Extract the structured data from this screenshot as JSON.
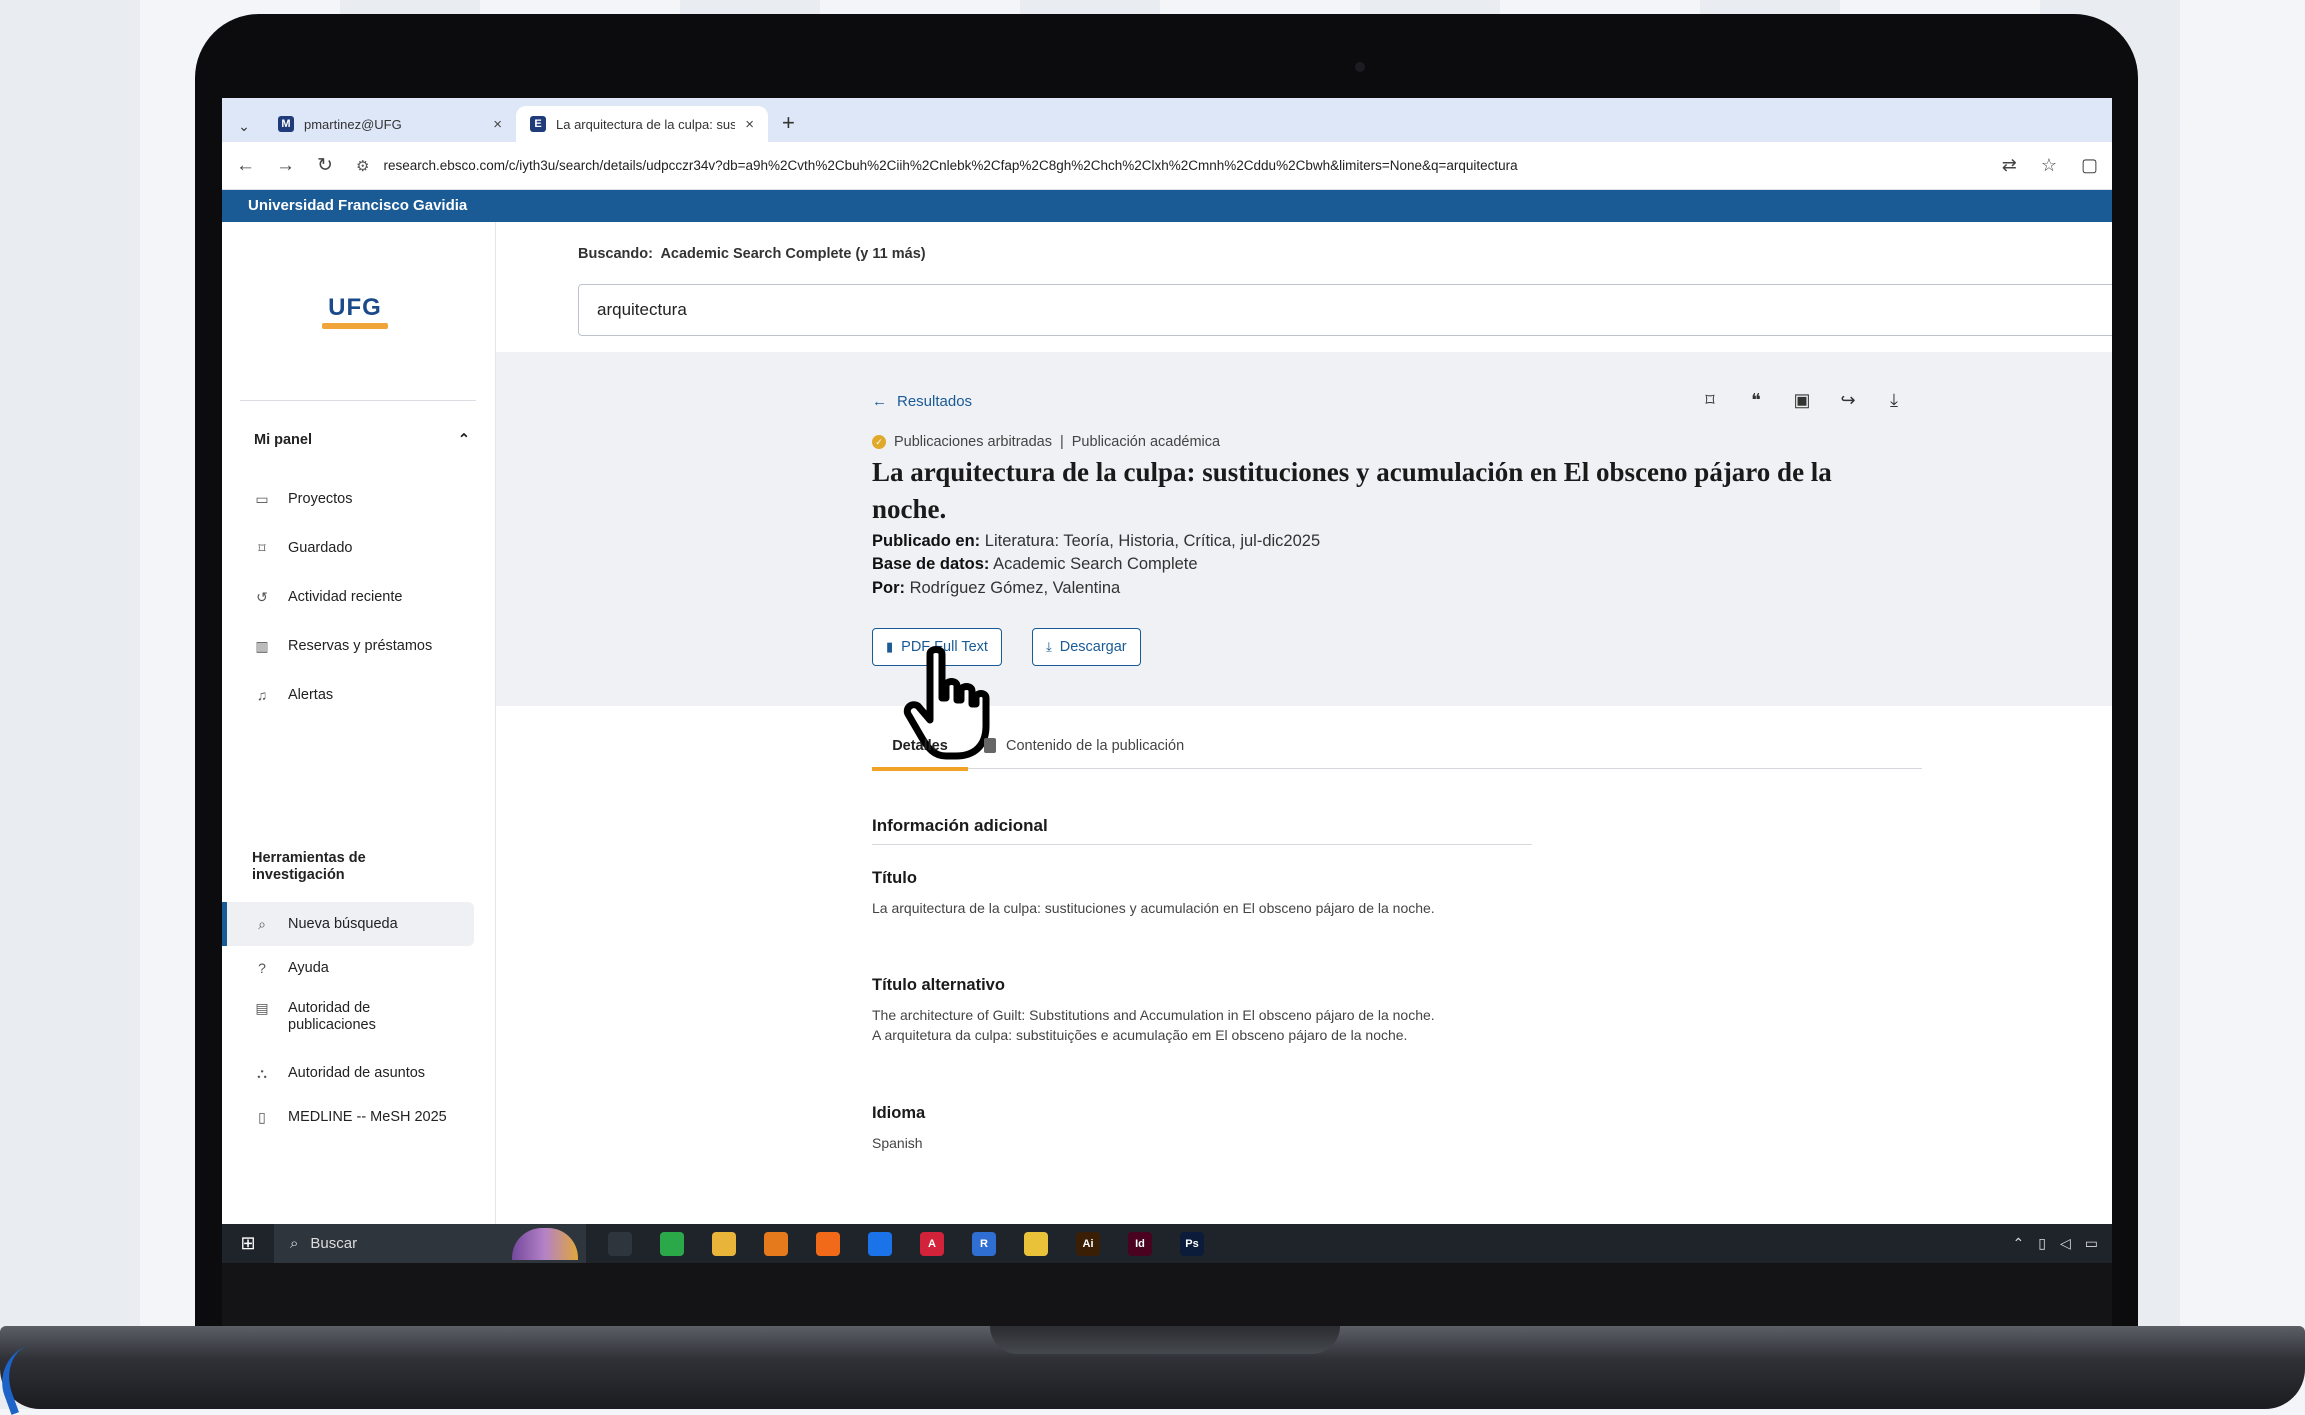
{
  "browser": {
    "tabs": [
      {
        "title": "pmartinez@UFG",
        "favicon": "M",
        "active": false
      },
      {
        "title": "La arquitectura de la culpa: sust",
        "favicon": "E",
        "active": true
      }
    ],
    "url": "research.ebsco.com/c/iyth3u/search/details/udpcczr34v?db=a9h%2Cvth%2Cbuh%2Ciih%2Cnlebk%2Cfap%2C8gh%2Chch%2Clxh%2Cmnh%2Cddu%2Cbwh&limiters=None&q=arquitectura"
  },
  "institution": "Universidad Francisco Gavidia",
  "logo": "UFG",
  "sidebar": {
    "panel_title": "Mi panel",
    "items": [
      {
        "label": "Proyectos",
        "icon": "folder-icon"
      },
      {
        "label": "Guardado",
        "icon": "bookmark-icon"
      },
      {
        "label": "Actividad reciente",
        "icon": "history-icon"
      },
      {
        "label": "Reservas y préstamos",
        "icon": "books-icon"
      },
      {
        "label": "Alertas",
        "icon": "bell-icon"
      }
    ],
    "tools_title_1": "Herramientas de",
    "tools_title_2": "investigación",
    "tools": [
      {
        "label": "Nueva búsqueda",
        "icon": "search-icon"
      },
      {
        "label": "Ayuda",
        "icon": "help-icon"
      },
      {
        "label_1": "Autoridad de",
        "label_2": "publicaciones",
        "icon": "document-icon"
      },
      {
        "label": "Autoridad de asuntos",
        "icon": "hierarchy-icon"
      },
      {
        "label": "MEDLINE -- MeSH 2025",
        "icon": "clipboard-icon"
      }
    ]
  },
  "search": {
    "scope_label": "Buscando:",
    "scope_value": "Academic Search Complete (y 11 más)",
    "query": "arquitectura"
  },
  "article": {
    "back_label": "Resultados",
    "badge_1": "Publicaciones arbitradas",
    "badge_2": "Publicación académica",
    "title": "La arquitectura de la culpa: sustituciones y acumulación en El obsceno pájaro de la noche.",
    "published_label": "Publicado en:",
    "published_value": "Literatura: Teoría, Historia, Crítica, jul-dic2025",
    "database_label": "Base de datos:",
    "database_value": "Academic Search Complete",
    "author_label": "Por:",
    "author_value": "Rodríguez Gómez, Valentina",
    "pdf_button": "PDF Full Text",
    "download_button": "Descargar"
  },
  "detail_tabs": {
    "details": "Detalles",
    "contents": "Contenido de la publicación"
  },
  "info": {
    "section_title": "Información adicional",
    "title_label": "Título",
    "title_value": "La arquitectura de la culpa: sustituciones y acumulación en El obsceno pájaro de la noche.",
    "alt_title_label": "Título alternativo",
    "alt_title_1": "The architecture of Guilt: Substitutions and Accumulation in El obsceno pájaro de la noche.",
    "alt_title_2": "A arquitetura da culpa: substituições e acumulação em El obsceno pájaro de la noche.",
    "language_label": "Idioma",
    "language_value": "Spanish"
  },
  "taskbar": {
    "search_label": "Buscar",
    "apps": [
      {
        "label": "",
        "color": "#2f353d"
      },
      {
        "label": "",
        "color": "#2aa84a"
      },
      {
        "label": "",
        "color": "#e8b43a"
      },
      {
        "label": "",
        "color": "#e47a1c"
      },
      {
        "label": "",
        "color": "#f06a1a"
      },
      {
        "label": "",
        "color": "#1a73e8"
      },
      {
        "label": "A",
        "color": "#d3233a"
      },
      {
        "label": "R",
        "color": "#2f6fd4"
      },
      {
        "label": "",
        "color": "#e9c23a"
      },
      {
        "label": "Ai",
        "color": "#3a1f06"
      },
      {
        "label": "Id",
        "color": "#49021f"
      },
      {
        "label": "Ps",
        "color": "#0a1c3a"
      }
    ]
  },
  "colors": {
    "brand_blue": "#1a5b96",
    "accent_orange": "#f0a126"
  }
}
